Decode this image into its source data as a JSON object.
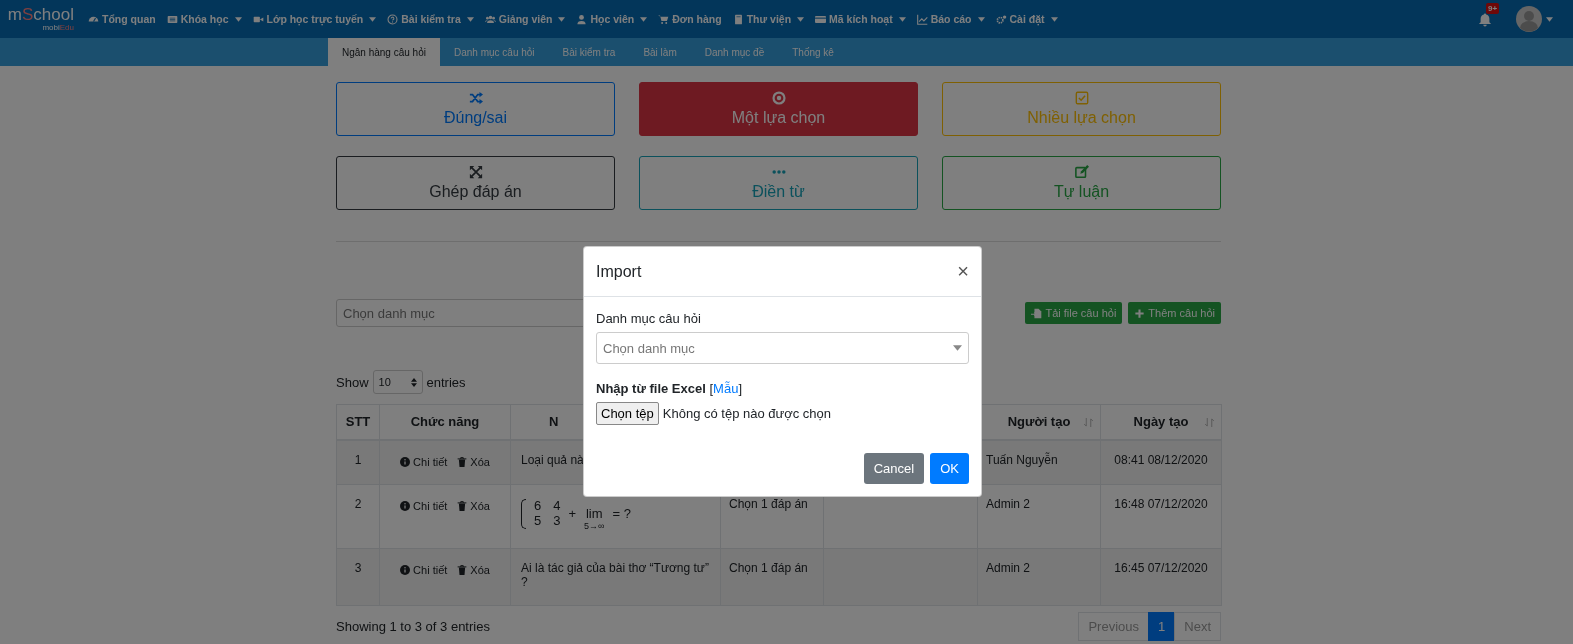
{
  "logo": {
    "brand": "mSchool",
    "sub": "mobiEdu"
  },
  "nav": [
    {
      "label": "Tổng quan",
      "has_menu": false
    },
    {
      "label": "Khóa học",
      "has_menu": true
    },
    {
      "label": "Lớp học trực tuyến",
      "has_menu": true
    },
    {
      "label": "Bài kiểm tra",
      "has_menu": true
    },
    {
      "label": "Giảng viên",
      "has_menu": true
    },
    {
      "label": "Học viên",
      "has_menu": true
    },
    {
      "label": "Đơn hàng",
      "has_menu": false
    },
    {
      "label": "Thư viện",
      "has_menu": true
    },
    {
      "label": "Mã kích hoạt",
      "has_menu": true
    },
    {
      "label": "Báo cáo",
      "has_menu": true
    },
    {
      "label": "Cài đặt",
      "has_menu": true
    }
  ],
  "notifications": {
    "badge": "9+"
  },
  "tabs": [
    {
      "label": "Ngân hàng câu hỏi",
      "selected": true
    },
    {
      "label": "Danh mục câu hỏi",
      "selected": false
    },
    {
      "label": "Bài kiểm tra",
      "selected": false
    },
    {
      "label": "Bài làm",
      "selected": false
    },
    {
      "label": "Danh mục đề",
      "selected": false
    },
    {
      "label": "Thống kê",
      "selected": false
    }
  ],
  "question_types": [
    {
      "label": "Đúng/sai",
      "kind": "primary",
      "selected": false
    },
    {
      "label": "Một lựa chọn",
      "kind": "danger",
      "selected": true
    },
    {
      "label": "Nhiều lựa chọn",
      "kind": "warning",
      "selected": false
    },
    {
      "label": "Ghép đáp án",
      "kind": "dark",
      "selected": false
    },
    {
      "label": "Điền từ",
      "kind": "info",
      "selected": false
    },
    {
      "label": "Tự luận",
      "kind": "success",
      "selected": false
    }
  ],
  "category_select": {
    "placeholder": "Chọn danh mục"
  },
  "actions": [
    "Tải file câu hỏi",
    "Thêm câu hỏi"
  ],
  "length": {
    "before": "Show",
    "value": "10",
    "after": "entries"
  },
  "table": {
    "columns": [
      {
        "label": "STT",
        "sortable": false
      },
      {
        "label": "Chức năng",
        "sortable": false
      },
      {
        "label": "N"
      },
      {
        "label": "Người tạo",
        "sortable": true
      },
      {
        "label": "Ngày tạo",
        "sortable": true
      }
    ],
    "rows": [
      {
        "stt": "1",
        "actions": [
          "Chi tiết",
          "Xóa"
        ],
        "kind": "text",
        "question": "Loại quả nà",
        "creator": "Tuấn Nguyễn",
        "created": "08:41 08/12/2020"
      },
      {
        "stt": "2",
        "actions": [
          "Chi tiết",
          "Xóa"
        ],
        "kind": "formula",
        "formula": {
          "matrix": [
            [
              "6",
              "4"
            ],
            [
              "5",
              "3"
            ]
          ],
          "op": "+",
          "lim": "lim",
          "lim_sub": "5→∞",
          "tail": "= ?"
        },
        "column_4": "Chọn 1 đáp án",
        "creator": "Admin 2",
        "created": "16:48 07/12/2020"
      },
      {
        "stt": "3",
        "actions": [
          "Chi tiết",
          "Xóa"
        ],
        "kind": "text",
        "question": "Ai là tác giả của bài thơ “Tương tư” ?",
        "column_4": "Chọn 1 đáp án",
        "creator": "Admin 2",
        "created": "16:45 07/12/2020"
      }
    ]
  },
  "info": "Showing 1 to 3 of 3 entries",
  "pagination": [
    {
      "label": "Previous",
      "selected": false,
      "disabled": true
    },
    {
      "label": "1",
      "selected": true,
      "disabled": false
    },
    {
      "label": "Next",
      "selected": false,
      "disabled": true
    }
  ],
  "modal": {
    "title": "Import",
    "close": "×",
    "category_label": "Danh mục câu hỏi",
    "category_placeholder": "Chọn danh mục",
    "file_label": "**Nhập từ file Excel** [",
    "file_link": "Mẫu",
    "file_label_end": "]",
    "file_button": "Chọn tệp",
    "file_status": "Không có tệp nào được chọn",
    "buttons": [
      {
        "label": "Cancel",
        "kind": "secondary"
      },
      {
        "label": "OK",
        "kind": "primary"
      }
    ]
  }
}
